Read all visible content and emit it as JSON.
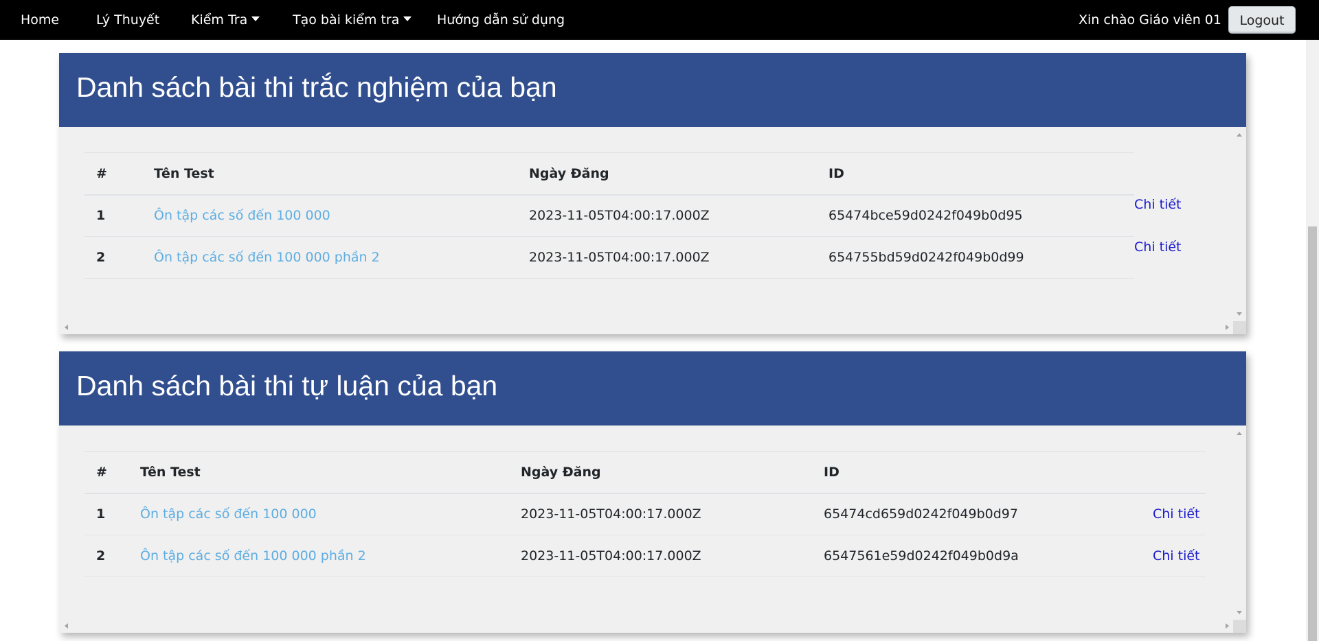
{
  "nav": {
    "items": [
      {
        "label": "Home"
      },
      {
        "label": "Lý Thuyết"
      },
      {
        "label": "Kiểm Tra"
      },
      {
        "label": "Tạo bài kiểm tra"
      },
      {
        "label": "Hướng dẫn sử dụng"
      }
    ],
    "greeting": "Xin chào Giáo viên 01",
    "logout_label": "Logout"
  },
  "mcq_section": {
    "title": "Danh sách bài thi trắc nghiệm của bạn",
    "columns": [
      "#",
      "Tên Test",
      "Ngày Đăng",
      "ID"
    ],
    "rows": [
      {
        "index": "1",
        "name": "Ôn tập các số đến 100 000",
        "date": "2023-11-05T04:00:17.000Z",
        "id": "65474bce59d0242f049b0d95",
        "action": "Chi tiết"
      },
      {
        "index": "2",
        "name": "Ôn tập các số đến 100 000 phần 2",
        "date": "2023-11-05T04:00:17.000Z",
        "id": "654755bd59d0242f049b0d99",
        "action": "Chi tiết"
      }
    ]
  },
  "essay_section": {
    "title": "Danh sách bài thi tự luận của bạn",
    "columns": [
      "#",
      "Tên Test",
      "Ngày Đăng",
      "ID"
    ],
    "rows": [
      {
        "index": "1",
        "name": "Ôn tập các số đến 100 000",
        "date": "2023-11-05T04:00:17.000Z",
        "id": "65474cd659d0242f049b0d97",
        "action": "Chi tiết"
      },
      {
        "index": "2",
        "name": "Ôn tập các số đến 100 000 phần 2",
        "date": "2023-11-05T04:00:17.000Z",
        "id": "6547561e59d0242f049b0d9a",
        "action": "Chi tiết"
      }
    ]
  },
  "colors": {
    "navbar_bg": "#000000",
    "header_bg": "#314f8f",
    "body_bg": "#f0f0f0",
    "name_link": "#5dade2",
    "detail_link": "#1a1acc"
  }
}
